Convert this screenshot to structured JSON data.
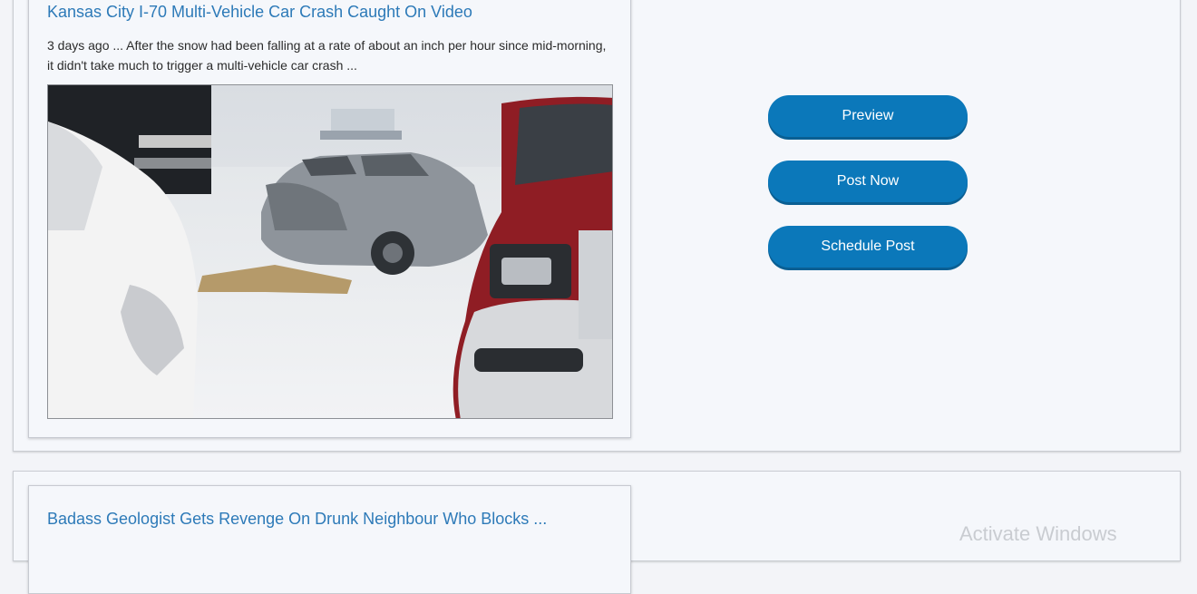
{
  "posts": [
    {
      "title": "Kansas City I-70 Multi-Vehicle Car Crash Caught On Video",
      "snippet": "3 days ago ... After the snow had been falling at a rate of about an inch per hour since mid-morning, it didn't take much to trigger a multi-vehicle car crash ...",
      "image_alt": "Snowy highway multi-vehicle car crash"
    },
    {
      "title": "Badass Geologist Gets Revenge On Drunk Neighbour Who Blocks ..."
    }
  ],
  "actions": {
    "preview_label": "Preview",
    "post_now_label": "Post Now",
    "schedule_label": "Schedule Post"
  },
  "watermark": "Activate Windows"
}
